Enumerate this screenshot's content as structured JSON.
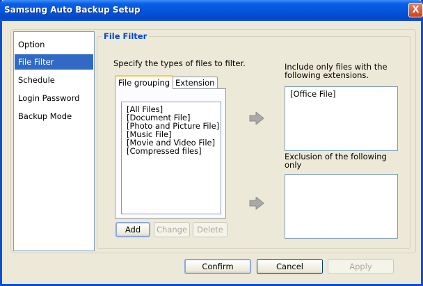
{
  "window": {
    "title": "Samsung Auto Backup Setup",
    "close_glyph": "X"
  },
  "sidebar": {
    "items": [
      {
        "label": "Option"
      },
      {
        "label": "File Filter"
      },
      {
        "label": "Schedule"
      },
      {
        "label": "Login Password"
      },
      {
        "label": "Backup Mode"
      }
    ],
    "active_index": 1
  },
  "file_filter": {
    "group_title": "File Filter",
    "instruction": "Specify the types of files to filter.",
    "tabs": [
      {
        "label": "File grouping"
      },
      {
        "label": "Extension"
      }
    ],
    "groups": [
      "[All Files]",
      "[Document File]",
      "[Photo and Picture File]",
      "[Music File]",
      "[Movie and Video File]",
      "[Compressed files]"
    ],
    "buttons": {
      "add": "Add",
      "change": "Change",
      "delete": "Delete"
    },
    "include": {
      "label_line1": "Include only files with the",
      "label_line2": "following extensions.",
      "items": [
        "[Office File]"
      ]
    },
    "exclude": {
      "label_line1": "Exclusion of the following",
      "label_line2": "only",
      "items": []
    }
  },
  "footer": {
    "confirm": "Confirm",
    "cancel": "Cancel",
    "apply": "Apply"
  },
  "colors": {
    "accent": "#316ac5",
    "title_bar": "#0653dc",
    "group_title": "#0046d5",
    "tab_highlight": "#ffc83c"
  }
}
